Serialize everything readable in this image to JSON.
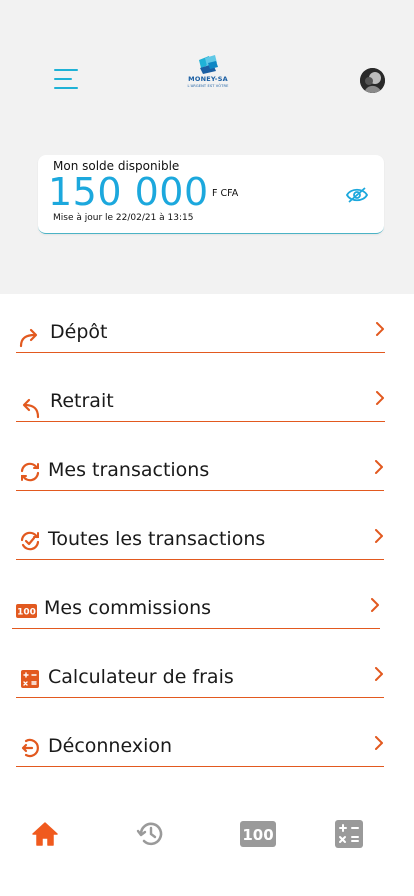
{
  "header": {
    "logo": {
      "brand": "MONEY-SA",
      "slogan": "L'ARGENT EST VÔTRE"
    },
    "menu_icon": "hamburger-menu-icon",
    "avatar_icon": "profile-avatar"
  },
  "balance": {
    "label": "Mon solde disponible",
    "amount": "150 000",
    "currency": "F CFA",
    "updated": "Mise à jour le 22/02/21 à 13:15",
    "visibility_icon": "eye-off-icon"
  },
  "menu": {
    "items": [
      {
        "label": "Dépôt",
        "icon": "redo-arrow-icon"
      },
      {
        "label": "Retrait",
        "icon": "undo-arrow-icon"
      },
      {
        "label": "Mes transactions",
        "icon": "refresh-icon"
      },
      {
        "label": "Toutes les transactions",
        "icon": "refresh-check-icon"
      },
      {
        "label": "Mes commissions",
        "icon": "100-badge-icon"
      },
      {
        "label": "Calculateur de frais",
        "icon": "calculator-icon"
      },
      {
        "label": "Déconnexion",
        "icon": "logout-icon"
      }
    ]
  },
  "tabbar": {
    "tabs": [
      {
        "name": "home",
        "icon": "home-icon",
        "active": true
      },
      {
        "name": "history",
        "icon": "history-icon",
        "active": false
      },
      {
        "name": "commissions",
        "icon": "100-badge-icon",
        "active": false
      },
      {
        "name": "calculator",
        "icon": "calculator-icon",
        "active": false
      }
    ]
  },
  "colors": {
    "accent": "#e2591f",
    "primary_blue": "#1ca8dd",
    "tab_active": "#f05a1e",
    "tab_inactive": "#9a9a9a",
    "header_bg": "#f2f2f2"
  }
}
